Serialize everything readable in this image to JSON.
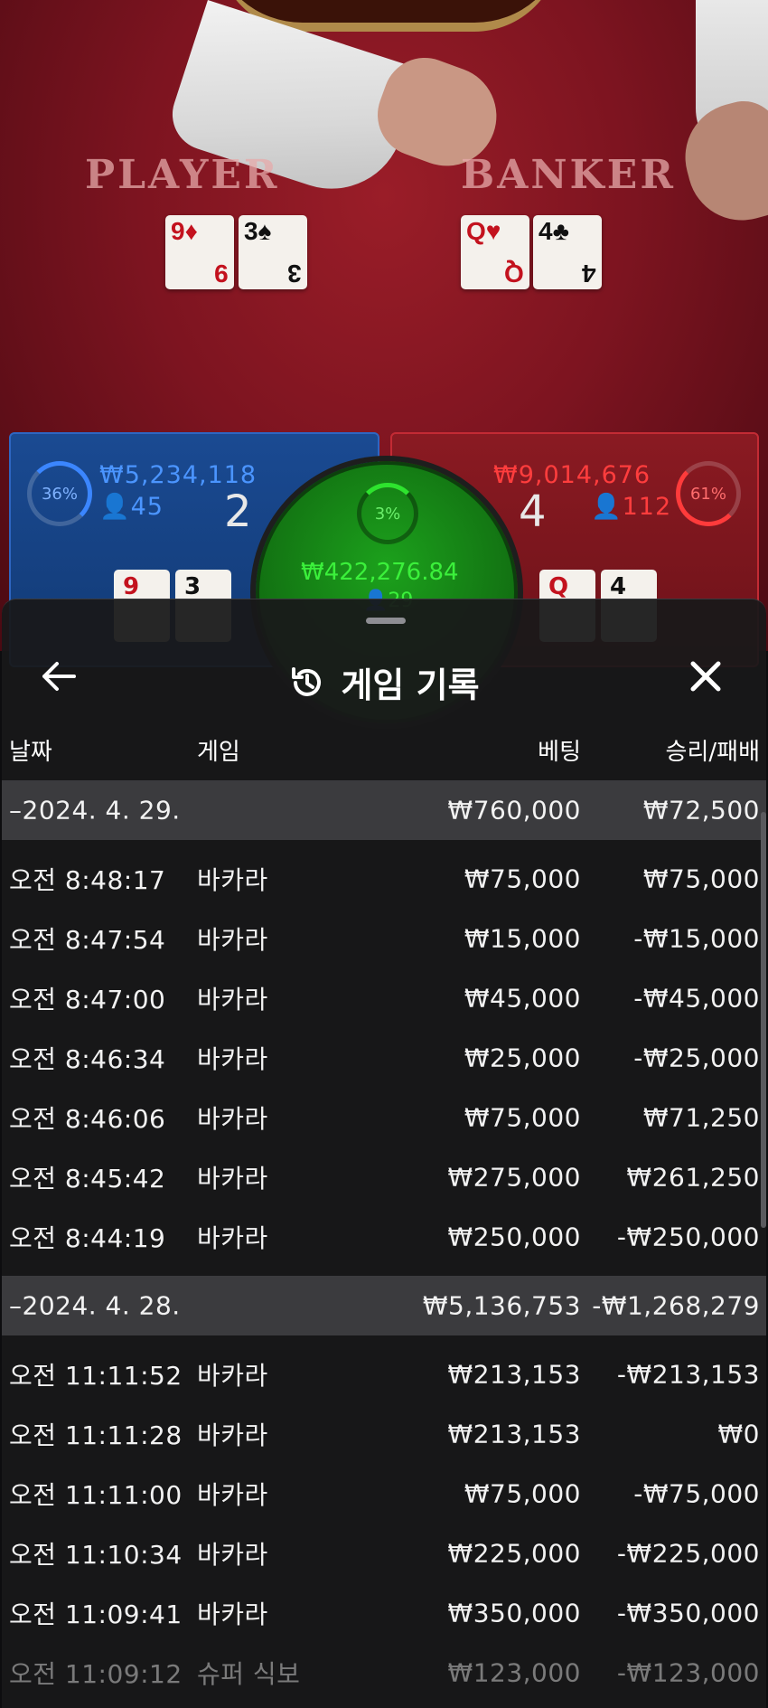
{
  "game": {
    "player_label": "PLAYER",
    "banker_label": "BANKER",
    "player_cards": [
      {
        "rank": "9",
        "suit": "♦",
        "color": "red"
      },
      {
        "rank": "3",
        "suit": "♠",
        "color": "black"
      }
    ],
    "banker_cards": [
      {
        "rank": "Q",
        "suit": "♥",
        "color": "red"
      },
      {
        "rank": "4",
        "suit": "♣",
        "color": "black"
      }
    ],
    "player_bet": {
      "percent": "36%",
      "amount": "₩5,234,118",
      "users": "45",
      "score": "2"
    },
    "banker_bet": {
      "percent": "61%",
      "amount": "₩9,014,676",
      "users": "112",
      "score": "4"
    },
    "tie_bet": {
      "percent": "3%",
      "amount": "₩422,276.84",
      "users": "29"
    }
  },
  "sheet": {
    "title": "게임 기록",
    "back_icon": "arrow-left-icon",
    "history_icon": "history-icon",
    "close_icon": "close-icon",
    "columns": {
      "date": "날짜",
      "game": "게임",
      "bet": "베팅",
      "result": "승리/패배"
    },
    "days": [
      {
        "date": "–2024. 4. 29.",
        "bet_total": "₩760,000",
        "result_total": "₩72,500",
        "entries": [
          {
            "time": "오전 8:48:17",
            "game": "바카라",
            "bet": "₩75,000",
            "result": "₩75,000"
          },
          {
            "time": "오전 8:47:54",
            "game": "바카라",
            "bet": "₩15,000",
            "result": "-₩15,000"
          },
          {
            "time": "오전 8:47:00",
            "game": "바카라",
            "bet": "₩45,000",
            "result": "-₩45,000"
          },
          {
            "time": "오전 8:46:34",
            "game": "바카라",
            "bet": "₩25,000",
            "result": "-₩25,000"
          },
          {
            "time": "오전 8:46:06",
            "game": "바카라",
            "bet": "₩75,000",
            "result": "₩71,250"
          },
          {
            "time": "오전 8:45:42",
            "game": "바카라",
            "bet": "₩275,000",
            "result": "₩261,250"
          },
          {
            "time": "오전 8:44:19",
            "game": "바카라",
            "bet": "₩250,000",
            "result": "-₩250,000"
          }
        ]
      },
      {
        "date": "–2024. 4. 28.",
        "bet_total": "₩5,136,753",
        "result_total": "-₩1,268,279",
        "entries": [
          {
            "time": "오전 11:11:52",
            "game": "바카라",
            "bet": "₩213,153",
            "result": "-₩213,153"
          },
          {
            "time": "오전 11:11:28",
            "game": "바카라",
            "bet": "₩213,153",
            "result": "₩0"
          },
          {
            "time": "오전 11:11:00",
            "game": "바카라",
            "bet": "₩75,000",
            "result": "-₩75,000"
          },
          {
            "time": "오전 11:10:34",
            "game": "바카라",
            "bet": "₩225,000",
            "result": "-₩225,000"
          },
          {
            "time": "오전 11:09:41",
            "game": "바카라",
            "bet": "₩350,000",
            "result": "-₩350,000"
          },
          {
            "time": "오전 11:09:12",
            "game": "슈퍼 식보",
            "bet": "₩123,000",
            "result": "-₩123,000"
          }
        ]
      }
    ]
  }
}
